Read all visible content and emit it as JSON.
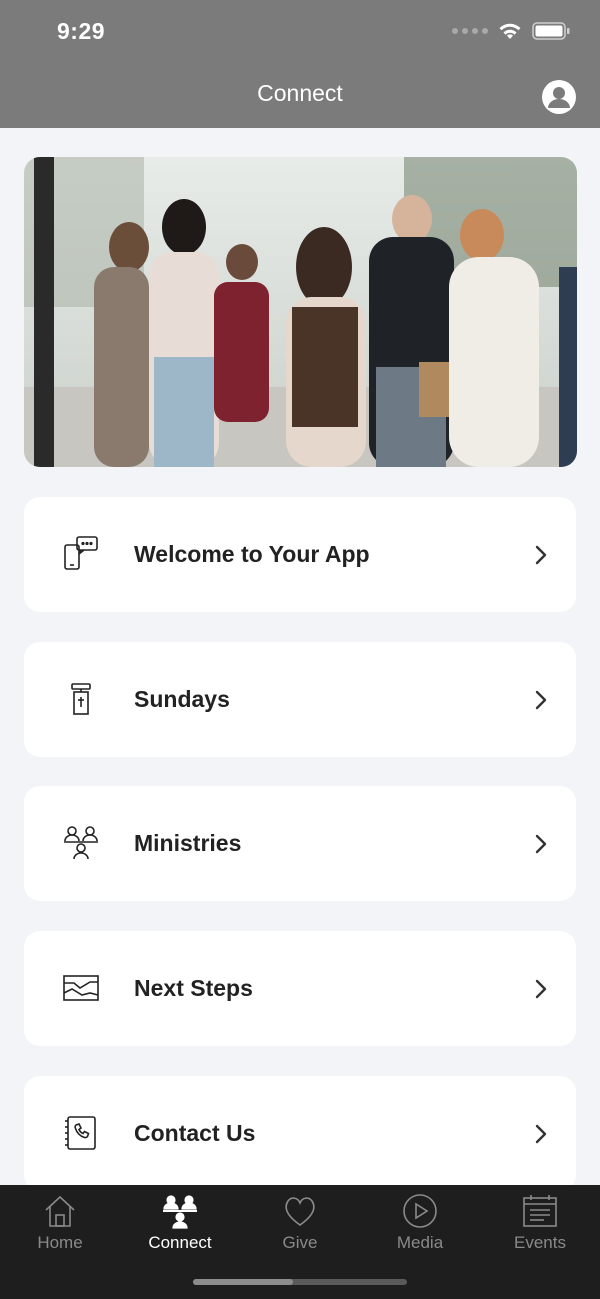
{
  "status_bar": {
    "time": "9:29"
  },
  "header": {
    "title": "Connect"
  },
  "hero": {
    "alt": "people-gathering-photo"
  },
  "menu": [
    {
      "label": "Welcome to Your App",
      "icon": "phone-chat-icon"
    },
    {
      "label": "Sundays",
      "icon": "pulpit-icon"
    },
    {
      "label": "Ministries",
      "icon": "people-group-icon"
    },
    {
      "label": "Next Steps",
      "icon": "steps-icon"
    },
    {
      "label": "Contact Us",
      "icon": "phone-book-icon"
    }
  ],
  "tabbar": [
    {
      "label": "Home",
      "icon": "home-icon",
      "active": false
    },
    {
      "label": "Connect",
      "icon": "connect-icon",
      "active": true
    },
    {
      "label": "Give",
      "icon": "heart-icon",
      "active": false
    },
    {
      "label": "Media",
      "icon": "play-icon",
      "active": false
    },
    {
      "label": "Events",
      "icon": "calendar-icon",
      "active": false
    }
  ],
  "colors": {
    "header_bg": "#7b7b7b",
    "page_bg": "#f3f4f8",
    "tabbar_bg": "#1e1e1e"
  }
}
